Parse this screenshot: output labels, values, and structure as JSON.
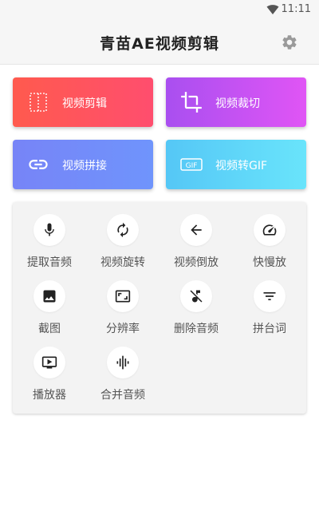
{
  "status_bar": {
    "time": "11:11"
  },
  "app_bar": {
    "title": "青苗AE视频剪辑",
    "settings_icon": "gear-icon"
  },
  "feature_cards": [
    {
      "label": "视频剪辑",
      "icon": "film-cut-icon",
      "colors": [
        "#ff5a4e",
        "#ff4e6e"
      ]
    },
    {
      "label": "视频裁切",
      "icon": "crop-icon",
      "colors": [
        "#a94ff0",
        "#e055f5"
      ]
    },
    {
      "label": "视频拼接",
      "icon": "link-icon",
      "colors": [
        "#7784f7",
        "#6f94fc"
      ]
    },
    {
      "label": "视频转GIF",
      "icon": "gif-icon",
      "colors": [
        "#55c7f6",
        "#69e4fb"
      ]
    }
  ],
  "tools": [
    {
      "label": "提取音频",
      "icon": "microphone-icon"
    },
    {
      "label": "视频旋转",
      "icon": "rotate-icon"
    },
    {
      "label": "视频倒放",
      "icon": "arrow-left-icon"
    },
    {
      "label": "快慢放",
      "icon": "speedometer-icon"
    },
    {
      "label": "截图",
      "icon": "image-icon"
    },
    {
      "label": "分辨率",
      "icon": "aspect-ratio-icon"
    },
    {
      "label": "删除音频",
      "icon": "music-off-icon"
    },
    {
      "label": "拼台词",
      "icon": "filter-lines-icon"
    },
    {
      "label": "播放器",
      "icon": "tv-play-icon"
    },
    {
      "label": "合并音频",
      "icon": "waveform-icon"
    }
  ]
}
